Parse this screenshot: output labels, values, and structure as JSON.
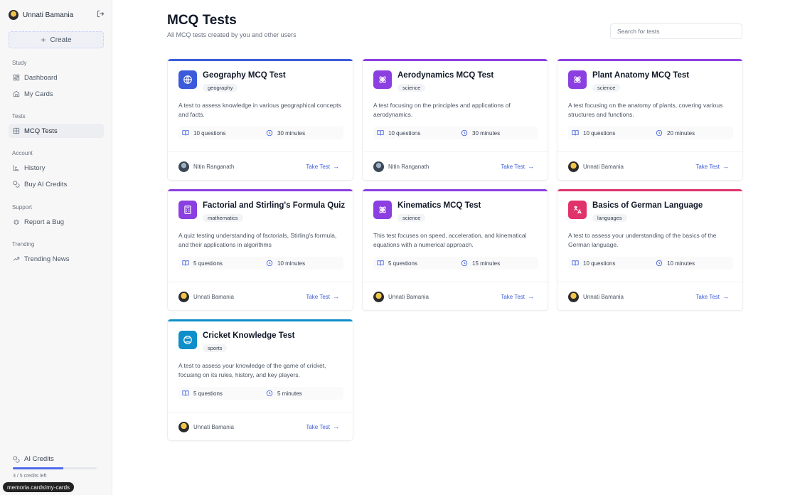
{
  "user": {
    "name": "Unnati Bamania"
  },
  "sidebar": {
    "create_label": "Create",
    "sections": {
      "study": "Study",
      "tests": "Tests",
      "account": "Account",
      "support": "Support",
      "trending": "Trending"
    },
    "items": {
      "dashboard": "Dashboard",
      "my_cards": "My Cards",
      "mcq_tests": "MCQ Tests",
      "history": "History",
      "buy_ai_credits": "Buy AI Credits",
      "report_bug": "Report a Bug",
      "trending_news": "Trending News"
    },
    "active_item": "mcq_tests",
    "credits": {
      "label": "AI Credits",
      "remaining_text": "3 / 5 credits left",
      "used_fraction": 0.6
    }
  },
  "status_url": "memoria.cards/my-cards",
  "main": {
    "title": "MCQ Tests",
    "subtitle": "All MCQ tests created by you and other users",
    "search_placeholder": "Search for tests"
  },
  "cards": [
    {
      "title": "Geography MCQ Test",
      "tag": "geography",
      "desc": "A test to assess knowledge in various geographical concepts and facts.",
      "questions": "10 questions",
      "duration": "30 minutes",
      "author": "Nitin Ranganath",
      "action": "Take Test",
      "icon": "globe-icon",
      "color": "#3b5bdb",
      "bar": "#3b5bdb"
    },
    {
      "title": "Aerodynamics MCQ Test",
      "tag": "science",
      "desc": "A test focusing on the principles and applications of aerodynamics.",
      "questions": "10 questions",
      "duration": "30 minutes",
      "author": "Nitin Ranganath",
      "action": "Take Test",
      "icon": "atom-icon",
      "color": "#8b3fe0",
      "bar": "#8b3fe0"
    },
    {
      "title": "Plant Anatomy MCQ Test",
      "tag": "science",
      "desc": "A test focusing on the anatomy of plants, covering various structures and functions.",
      "questions": "10 questions",
      "duration": "20 minutes",
      "author": "Unnati Bamania",
      "action": "Take Test",
      "icon": "atom-icon",
      "color": "#8b3fe0",
      "bar": "#8b3fe0"
    },
    {
      "title": "Factorial and Stirling's Formula Quiz",
      "tag": "mathematics",
      "desc": "A quiz testing understanding of factorials, Stirling's formula, and their applications in algorithms",
      "questions": "5 questions",
      "duration": "10 minutes",
      "author": "Unnati Bamania",
      "action": "Take Test",
      "icon": "calculator-icon",
      "color": "#8b3fe0",
      "bar": "#8b3fe0"
    },
    {
      "title": "Kinematics MCQ Test",
      "tag": "science",
      "desc": "This test focuses on speed, acceleration, and kinematical equations with a numerical approach.",
      "questions": "5 questions",
      "duration": "15 minutes",
      "author": "Unnati Bamania",
      "action": "Take Test",
      "icon": "atom-icon",
      "color": "#8b3fe0",
      "bar": "#8b3fe0"
    },
    {
      "title": "Basics of German Language",
      "tag": "languages",
      "desc": "A test to assess your understanding of the basics of the German language.",
      "questions": "10 questions",
      "duration": "10 minutes",
      "author": "Unnati Bamania",
      "action": "Take Test",
      "icon": "translate-icon",
      "color": "#e0336b",
      "bar": "#e0336b"
    },
    {
      "title": "Cricket Knowledge Test",
      "tag": "sports",
      "desc": "A test to assess your knowledge of the game of cricket, focusing on its rules, history, and key players.",
      "questions": "5 questions",
      "duration": "5 minutes",
      "author": "Unnati Bamania",
      "action": "Take Test",
      "icon": "ball-icon",
      "color": "#0e8fc9",
      "bar": "#0e8fc9"
    }
  ]
}
